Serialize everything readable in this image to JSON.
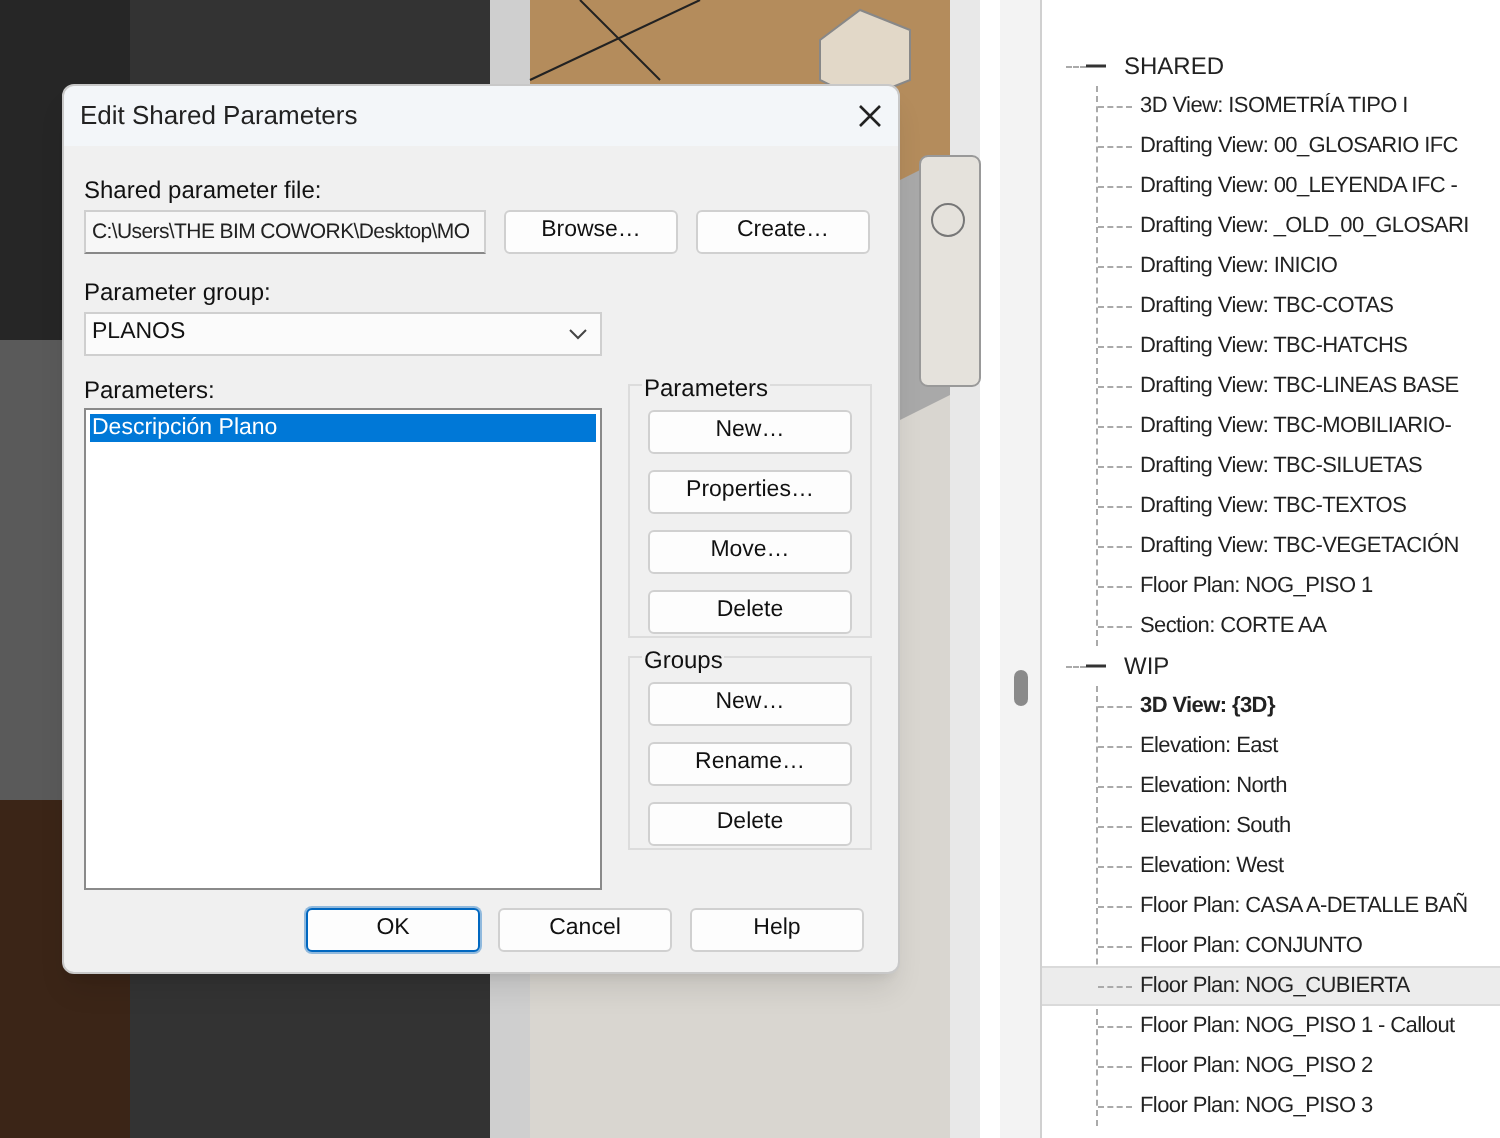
{
  "dialog": {
    "title": "Edit Shared Parameters",
    "file_label": "Shared parameter file:",
    "file_path": "C:\\Users\\THE BIM COWORK\\Desktop\\MO",
    "file_buttons": [
      "Browse…",
      "Create…"
    ],
    "group_label": "Parameter group:",
    "group_value": "PLANOS",
    "parameters_label": "Parameters:",
    "parameters": [
      {
        "label": "Descripción Plano",
        "selected": true
      }
    ],
    "parameter_actions": {
      "title": "Parameters",
      "buttons": [
        "New…",
        "Properties…",
        "Move…",
        "Delete"
      ]
    },
    "group_actions": {
      "title": "Groups",
      "buttons": [
        "New…",
        "Rename…",
        "Delete"
      ]
    },
    "footer_buttons": [
      {
        "label": "OK",
        "default": true
      },
      {
        "label": "Cancel",
        "default": false
      },
      {
        "label": "Help",
        "default": false
      }
    ]
  },
  "project_browser": {
    "groups": [
      {
        "label": "SHARED",
        "expanded": true,
        "children": [
          {
            "label": "3D View: ISOMETRÍA TIPO I",
            "active": false,
            "selected": false
          },
          {
            "label": "Drafting View: 00_GLOSARIO IFC",
            "active": false,
            "selected": false
          },
          {
            "label": "Drafting View: 00_LEYENDA IFC -",
            "active": false,
            "selected": false
          },
          {
            "label": "Drafting View: _OLD_00_GLOSARI",
            "active": false,
            "selected": false
          },
          {
            "label": "Drafting View: INICIO",
            "active": false,
            "selected": false
          },
          {
            "label": "Drafting View: TBC-COTAS",
            "active": false,
            "selected": false
          },
          {
            "label": "Drafting View: TBC-HATCHS",
            "active": false,
            "selected": false
          },
          {
            "label": "Drafting View: TBC-LINEAS BASE",
            "active": false,
            "selected": false
          },
          {
            "label": "Drafting View: TBC-MOBILIARIO-",
            "active": false,
            "selected": false
          },
          {
            "label": "Drafting View: TBC-SILUETAS",
            "active": false,
            "selected": false
          },
          {
            "label": "Drafting View: TBC-TEXTOS",
            "active": false,
            "selected": false
          },
          {
            "label": "Drafting View: TBC-VEGETACIÓN",
            "active": false,
            "selected": false
          },
          {
            "label": "Floor Plan: NOG_PISO 1",
            "active": false,
            "selected": false
          },
          {
            "label": "Section: CORTE AA",
            "active": false,
            "selected": false
          }
        ]
      },
      {
        "label": "WIP",
        "expanded": true,
        "children": [
          {
            "label": "3D View: {3D}",
            "active": true,
            "selected": false
          },
          {
            "label": "Elevation: East",
            "active": false,
            "selected": false
          },
          {
            "label": "Elevation: North",
            "active": false,
            "selected": false
          },
          {
            "label": "Elevation: South",
            "active": false,
            "selected": false
          },
          {
            "label": "Elevation: West",
            "active": false,
            "selected": false
          },
          {
            "label": "Floor Plan: CASA A-DETALLE BAÑ",
            "active": false,
            "selected": false
          },
          {
            "label": "Floor Plan: CONJUNTO",
            "active": false,
            "selected": false
          },
          {
            "label": "Floor Plan: NOG_CUBIERTA",
            "active": false,
            "selected": true
          },
          {
            "label": "Floor Plan: NOG_PISO 1 - Callout",
            "active": false,
            "selected": false
          },
          {
            "label": "Floor Plan: NOG_PISO 2",
            "active": false,
            "selected": false
          },
          {
            "label": "Floor Plan: NOG_PISO 3",
            "active": false,
            "selected": false
          }
        ]
      }
    ]
  }
}
